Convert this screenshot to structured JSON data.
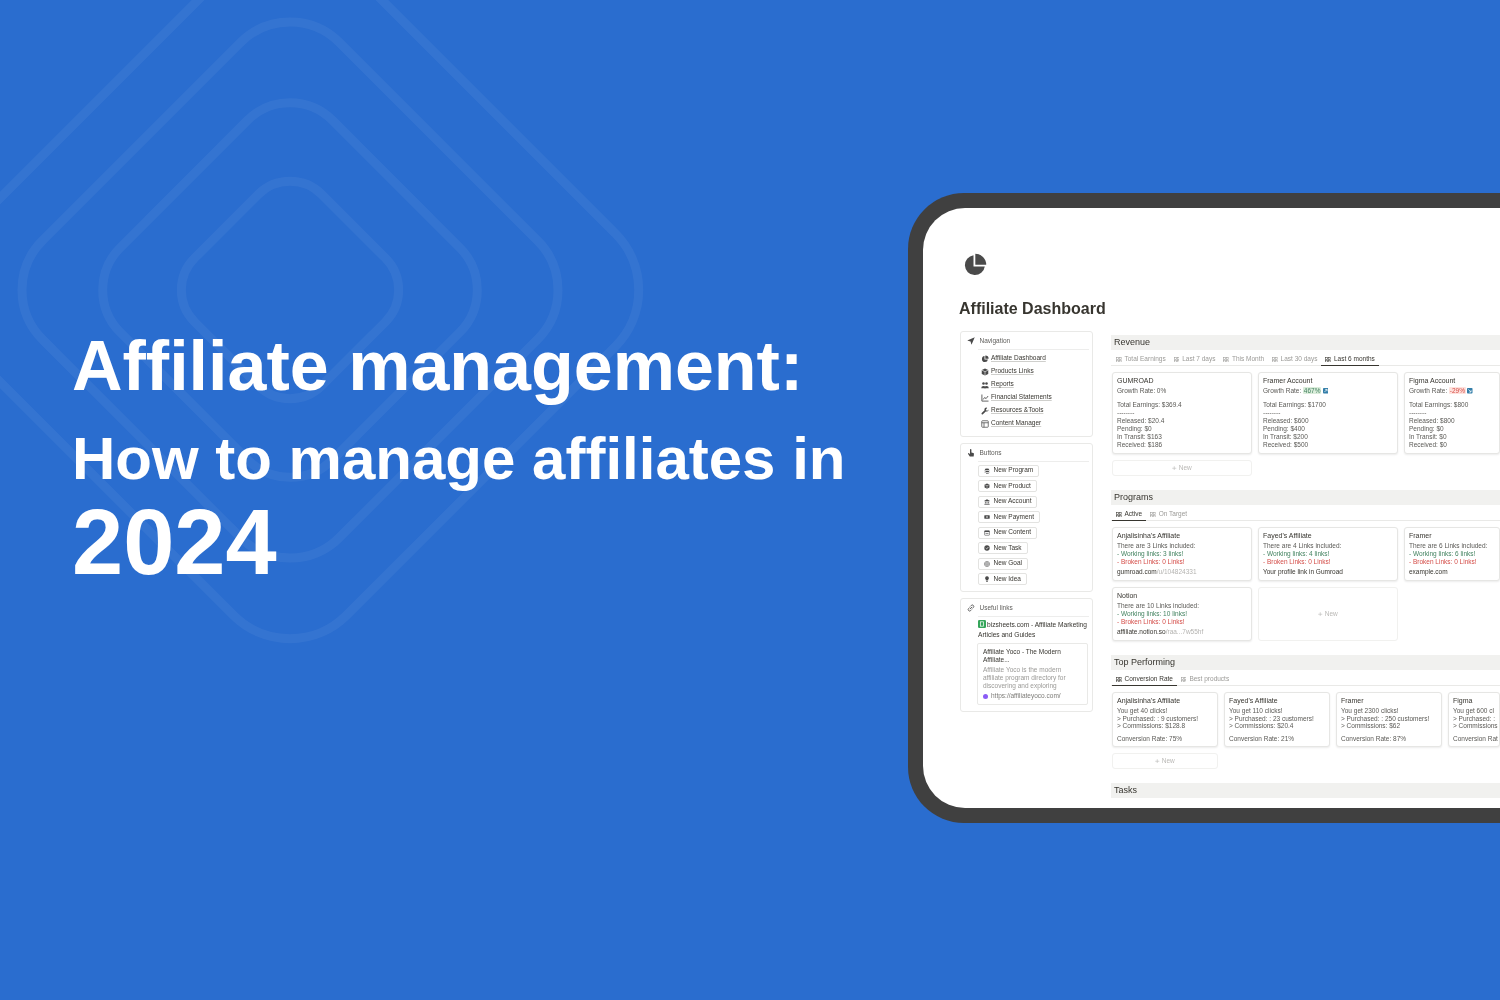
{
  "headline": {
    "title": "Affiliate management:",
    "subtitle": "How to manage affiliates in",
    "year": "2024"
  },
  "page": {
    "title": "Affiliate Dashboard"
  },
  "sidebar": [
    {
      "kind": "links",
      "title": "Navigation",
      "items": [
        "Affiliate Dashboard",
        "Products Links",
        "Reports",
        "Financial Statements",
        "Resources &Tools",
        "Content Manager"
      ]
    },
    {
      "kind": "buttons",
      "title": "Buttons",
      "items": [
        "New Program",
        "New Product",
        "New Account",
        "New Payment",
        "New Content",
        "New Task",
        "New Goal",
        "New Idea"
      ]
    },
    {
      "kind": "bookmarks",
      "title": "Useful links",
      "link": "bizsheets.com - Affiliate Marketing Articles and Guides",
      "bookmark": {
        "title": "Affiliate Yoco - The Modern Affiliate...",
        "description": "Affiliate Yoco is the modern affiliate program directory for discovering and exploring",
        "url": "https://affiliateyoco.com/"
      }
    }
  ],
  "sections": [
    {
      "kind": "gallery",
      "title": "Revenue",
      "tabs": [
        {
          "label": "Total Earnings",
          "selected": false
        },
        {
          "label": "Last 7 days",
          "selected": false
        },
        {
          "label": "This Month",
          "selected": false
        },
        {
          "label": "Last 30 days",
          "selected": false
        },
        {
          "label": "Last 6 months",
          "selected": true
        }
      ],
      "cards": [
        {
          "title": "GUMROAD",
          "blocks": [
            [
              {
                "kind": "growth",
                "text": "Growth Rate:",
                "value": "0%"
              }
            ],
            [
              {
                "kind": "plain",
                "text": "Total Earnings: $369.4"
              },
              {
                "kind": "plain",
                "text": "--------"
              },
              {
                "kind": "plain",
                "text": "Released: $20.4"
              },
              {
                "kind": "plain",
                "text": "Pending: $0"
              },
              {
                "kind": "plain",
                "text": "In Transit: $163"
              },
              {
                "kind": "plain",
                "text": "Received: $186"
              }
            ]
          ]
        },
        {
          "title": "Framer Account",
          "blocks": [
            [
              {
                "kind": "rise",
                "text": "Growth Rate:",
                "value": "467%"
              }
            ],
            [
              {
                "kind": "plain",
                "text": "Total Earnings: $1700"
              },
              {
                "kind": "plain",
                "text": "--------"
              },
              {
                "kind": "plain",
                "text": "Released: $600"
              },
              {
                "kind": "plain",
                "text": "Pending: $400"
              },
              {
                "kind": "plain",
                "text": "In Transit: $200"
              },
              {
                "kind": "plain",
                "text": "Received: $500"
              }
            ]
          ]
        },
        {
          "title": "Figma Account",
          "blocks": [
            [
              {
                "kind": "fall",
                "text": "Growth Rate:",
                "value": "-29%"
              }
            ],
            [
              {
                "kind": "plain",
                "text": "Total Earnings: $800"
              },
              {
                "kind": "plain",
                "text": "--------"
              },
              {
                "kind": "plain",
                "text": "Released: $800"
              },
              {
                "kind": "plain",
                "text": "Pending: $0"
              },
              {
                "kind": "plain",
                "text": "In Transit: $0"
              },
              {
                "kind": "plain",
                "text": "Received: $0"
              }
            ]
          ]
        }
      ],
      "new_label": "New"
    },
    {
      "kind": "gallery",
      "title": "Programs",
      "tabs": [
        {
          "label": "Active",
          "selected": true
        },
        {
          "label": "On Target",
          "selected": false
        }
      ],
      "cards": [
        {
          "title": "Anjalisinha's Affiliate",
          "blocks": [
            [
              {
                "kind": "plain",
                "text": "There are 3 Links included:"
              },
              {
                "kind": "good",
                "text": "- Working links: 3 links!"
              },
              {
                "kind": "bad",
                "text": "- Broken Links: 0 Links!"
              },
              {
                "kind": "link",
                "text": "gumroad.com",
                "faded": "/u/104824331"
              }
            ]
          ]
        },
        {
          "title": "Fayed's Affiliate",
          "blocks": [
            [
              {
                "kind": "plain",
                "text": "There are 4 Links included:"
              },
              {
                "kind": "good",
                "text": "- Working links: 4 links!"
              },
              {
                "kind": "bad",
                "text": "- Broken Links: 0 Links!"
              },
              {
                "kind": "link",
                "text": "Your profile link in Gumroad"
              }
            ]
          ]
        },
        {
          "title": "Framer",
          "blocks": [
            [
              {
                "kind": "plain",
                "text": "There are 6 Links included:"
              },
              {
                "kind": "good",
                "text": "- Working links: 6 links!"
              },
              {
                "kind": "bad",
                "text": "- Broken Links: 0 Links!"
              },
              {
                "kind": "link",
                "text": "example.com"
              }
            ]
          ]
        },
        {
          "title": "Notion",
          "blocks": [
            [
              {
                "kind": "plain",
                "text": "There are 10 Links included:"
              },
              {
                "kind": "good",
                "text": "- Working links: 10 links!"
              },
              {
                "kind": "bad",
                "text": "- Broken Links: 0 Links!"
              },
              {
                "kind": "link",
                "text": "affiliate.notion.so",
                "faded": "/raa...7w55hf"
              }
            ]
          ]
        }
      ],
      "new_label": "New"
    },
    {
      "kind": "compact",
      "title": "Top Performing",
      "tabs": [
        {
          "label": "Conversion Rate",
          "selected": true
        },
        {
          "label": "Best products",
          "selected": false
        }
      ],
      "cards": [
        {
          "title": "Anjalisinha's Affiliate",
          "blocks": [
            [
              {
                "kind": "plain",
                "text": "You get 40 clicks!"
              },
              {
                "kind": "plain",
                "text": "> Purchased: : 9 customers!"
              },
              {
                "kind": "plain",
                "text": "> Commissions: $128.8"
              }
            ],
            [
              {
                "kind": "plain",
                "text": "Conversion Rate: 75%"
              }
            ]
          ]
        },
        {
          "title": "Fayed's Affiliate",
          "blocks": [
            [
              {
                "kind": "plain",
                "text": "You get 110 clicks!"
              },
              {
                "kind": "plain",
                "text": "> Purchased: : 23 customers!"
              },
              {
                "kind": "plain",
                "text": "> Commissions: $20.4"
              }
            ],
            [
              {
                "kind": "plain",
                "text": "Conversion Rate: 21%"
              }
            ]
          ]
        },
        {
          "title": "Framer",
          "blocks": [
            [
              {
                "kind": "plain",
                "text": "You get 2300 clicks!"
              },
              {
                "kind": "plain",
                "text": "> Purchased: : 250 customers!"
              },
              {
                "kind": "plain",
                "text": "> Commissions: $62"
              }
            ],
            [
              {
                "kind": "plain",
                "text": "Conversion Rate: 87%"
              }
            ]
          ]
        },
        {
          "title": "Figma",
          "blocks": [
            [
              {
                "kind": "plain",
                "text": "You get 600 cl"
              },
              {
                "kind": "plain",
                "text": "> Purchased: :"
              },
              {
                "kind": "plain",
                "text": "> Commissions"
              }
            ],
            [
              {
                "kind": "plain",
                "text": "Conversion Rat"
              }
            ]
          ]
        }
      ],
      "new_label": "New"
    },
    {
      "kind": "header",
      "title": "Tasks"
    }
  ]
}
